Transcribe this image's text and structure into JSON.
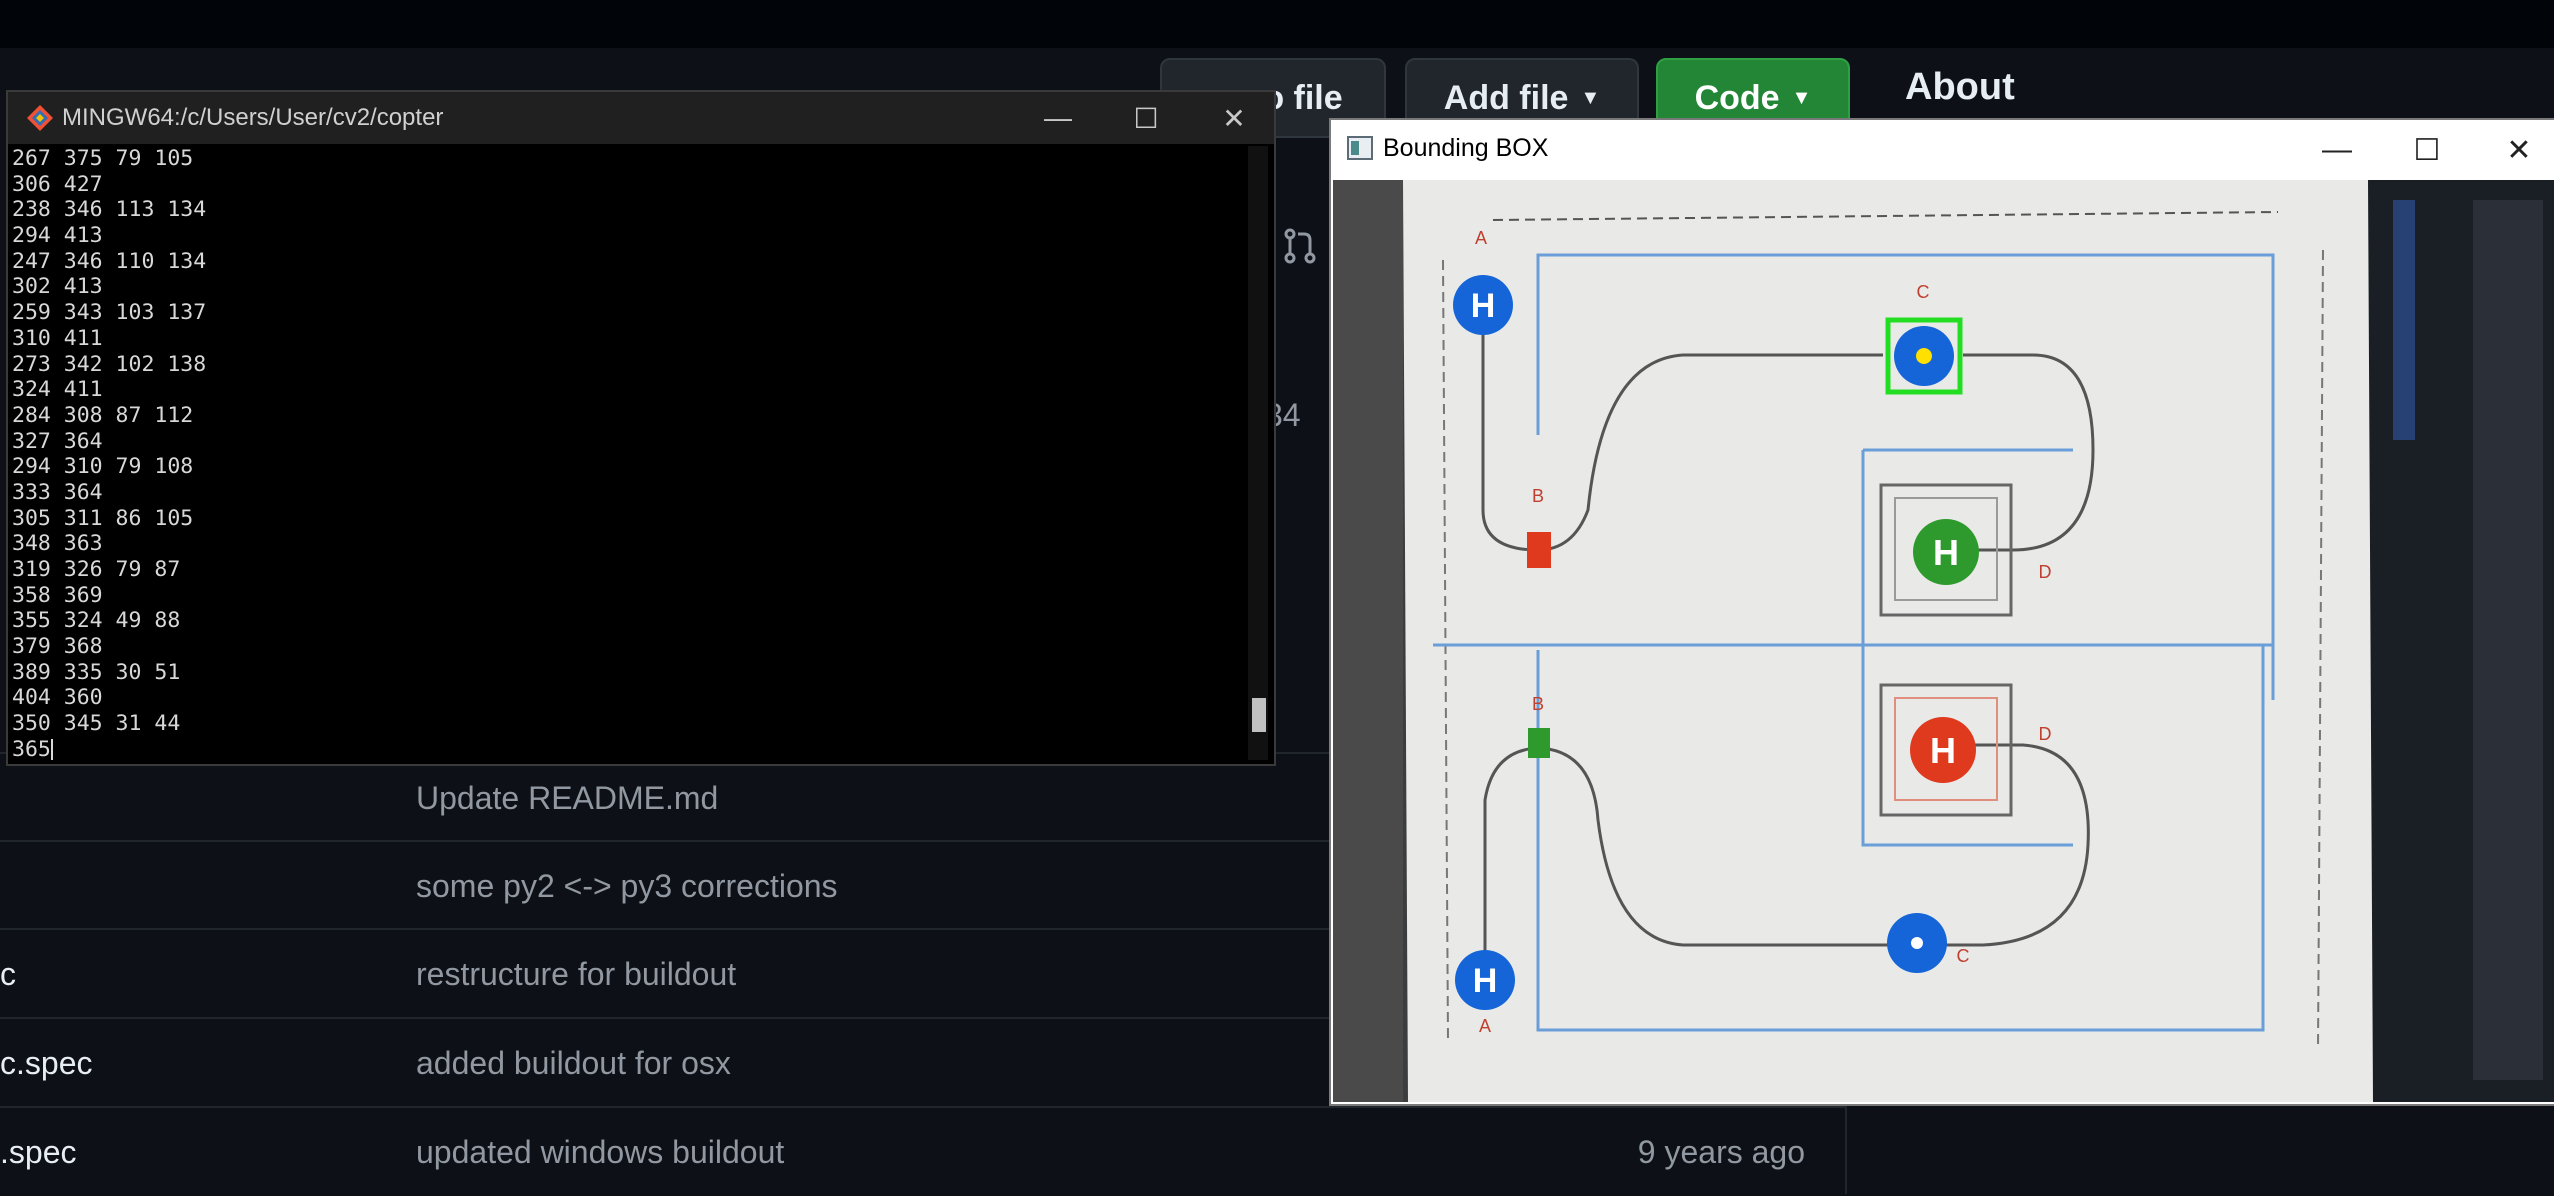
{
  "github": {
    "buttons": {
      "go_to_file": "o file",
      "add_file": "Add file",
      "code": "Code"
    },
    "about_heading": "About",
    "partial_count": "34",
    "files": [
      {
        "name": "",
        "message": "Update README.md",
        "time": ""
      },
      {
        "name": "",
        "message": "some py2 <-> py3 corrections",
        "time": ""
      },
      {
        "name": "c",
        "message": "restructure for buildout",
        "time": ""
      },
      {
        "name": "c.spec",
        "message": "added buildout for osx",
        "time": ""
      },
      {
        "name": ".spec",
        "message": "updated windows buildout",
        "time": "9 years ago"
      }
    ]
  },
  "terminal": {
    "title": "MINGW64:/c/Users/User/cv2/copter",
    "lines": [
      "267 375 79 105",
      "306 427",
      "238 346 113 134",
      "294 413",
      "247 346 110 134",
      "302 413",
      "259 343 103 137",
      "310 411",
      "273 342 102 138",
      "324 411",
      "284 308 87 112",
      "327 364",
      "294 310 79 108",
      "333 364",
      "305 311 86 105",
      "348 363",
      "319 326 79 87",
      "358 369",
      "355 324 49 88",
      "379 368",
      "389 335 30 51",
      "404 360",
      "350 345 31 44",
      "365"
    ],
    "controls": {
      "minimize": "—",
      "maximize": "☐",
      "close": "✕"
    }
  },
  "bounding_box_window": {
    "title": "Bounding BOX",
    "controls": {
      "minimize": "—",
      "maximize": "☐",
      "close": "✕"
    },
    "markers": {
      "h_label": "H",
      "letters": [
        "A",
        "B",
        "C",
        "D"
      ]
    },
    "colors": {
      "blue": "#1565d8",
      "green": "#2e9a2e",
      "red": "#e03a1e",
      "detection_box": "#22dd22",
      "detection_center": "#ffe000"
    }
  }
}
